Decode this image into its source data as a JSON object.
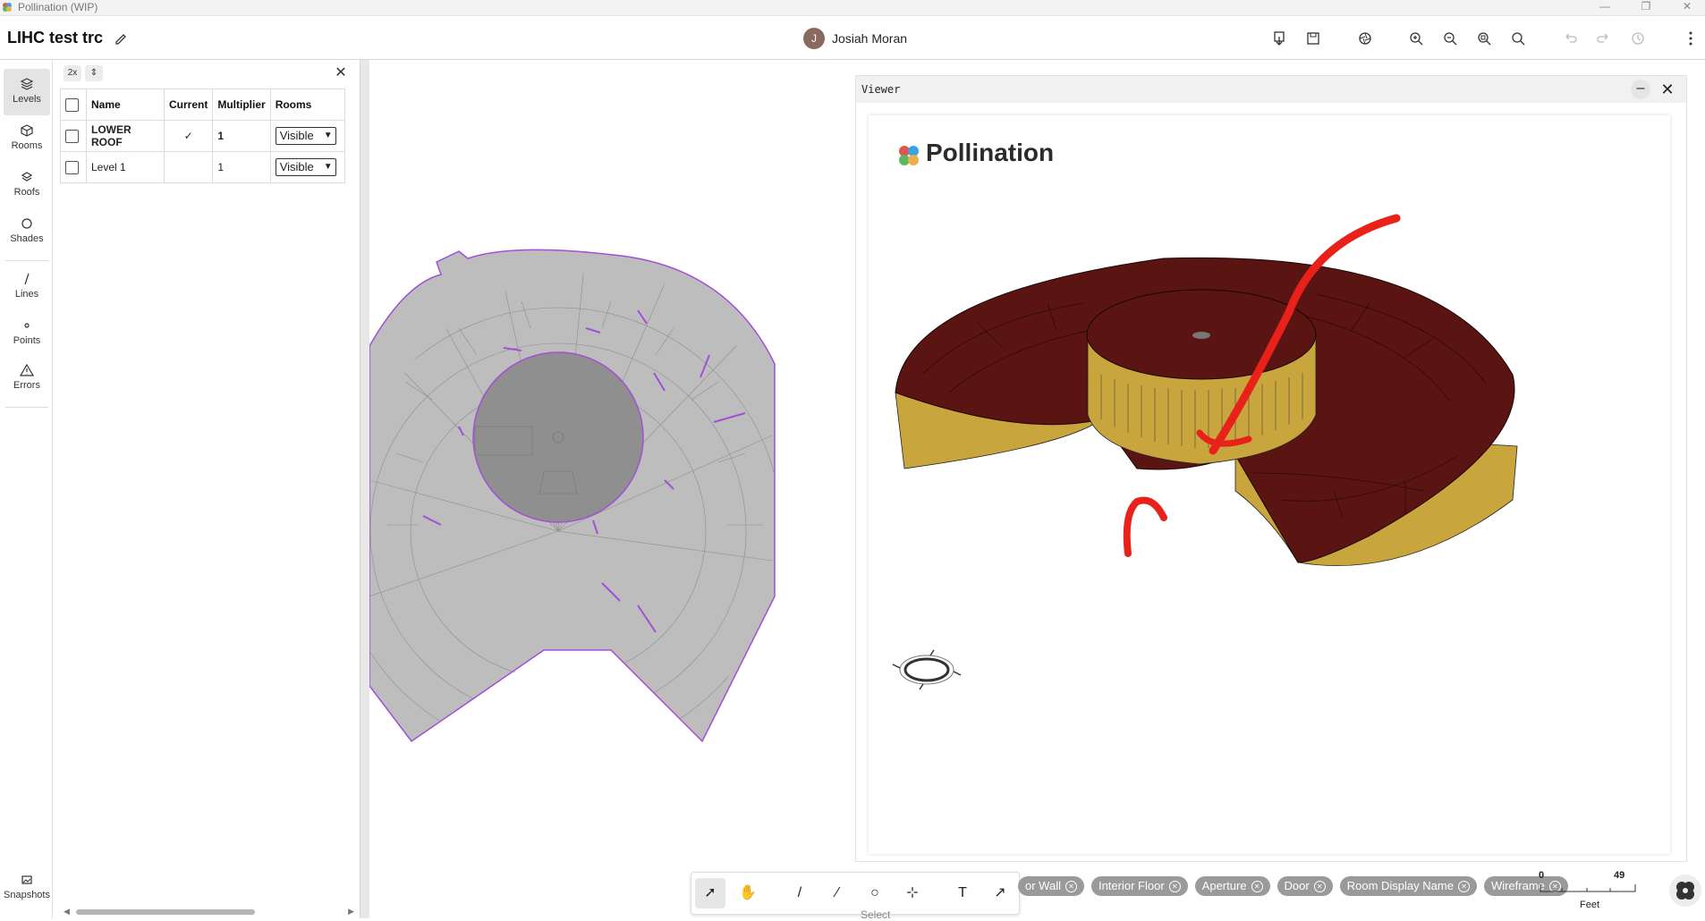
{
  "window": {
    "title": "Pollination (WIP)"
  },
  "header": {
    "project_title": "LIHC test trc",
    "user_name": "Josiah Moran",
    "user_initial": "J"
  },
  "rail": {
    "items": [
      {
        "label": "Levels",
        "icon": "layers-icon"
      },
      {
        "label": "Rooms",
        "icon": "cube-icon"
      },
      {
        "label": "Roofs",
        "icon": "roof-layers-icon"
      },
      {
        "label": "Shades",
        "icon": "circle-icon"
      },
      {
        "label": "Lines",
        "icon": "line-icon"
      },
      {
        "label": "Points",
        "icon": "point-icon"
      },
      {
        "label": "Errors",
        "icon": "warning-icon"
      },
      {
        "label": "Snapshots",
        "icon": "image-icon"
      }
    ]
  },
  "levels_table": {
    "headers": {
      "name": "Name",
      "current": "Current",
      "multiplier": "Multiplier",
      "rooms": "Rooms"
    },
    "rows": [
      {
        "name": "LOWER ROOF",
        "current": "✓",
        "multiplier": "1",
        "rooms": "Visible"
      },
      {
        "name": "Level 1",
        "current": "",
        "multiplier": "1",
        "rooms": "Visible"
      }
    ]
  },
  "panel_tools": {
    "tool1": "2x",
    "tool2": "⇕"
  },
  "viewer": {
    "title": "Viewer",
    "brand": "Pollination"
  },
  "chips": [
    {
      "label": "or Wall"
    },
    {
      "label": "Interior Floor"
    },
    {
      "label": "Aperture"
    },
    {
      "label": "Door"
    },
    {
      "label": "Room Display Name"
    },
    {
      "label": "Wireframe"
    }
  ],
  "scale": {
    "min": "0",
    "max": "49",
    "unit": "Feet"
  },
  "status": {
    "hint": "Select"
  },
  "colors": {
    "roof": "#5a1412",
    "wall": "#c9a53e",
    "plan_fill": "#bdbdbd",
    "plan_edge": "#a34fd6",
    "annotation": "#e8211b"
  }
}
